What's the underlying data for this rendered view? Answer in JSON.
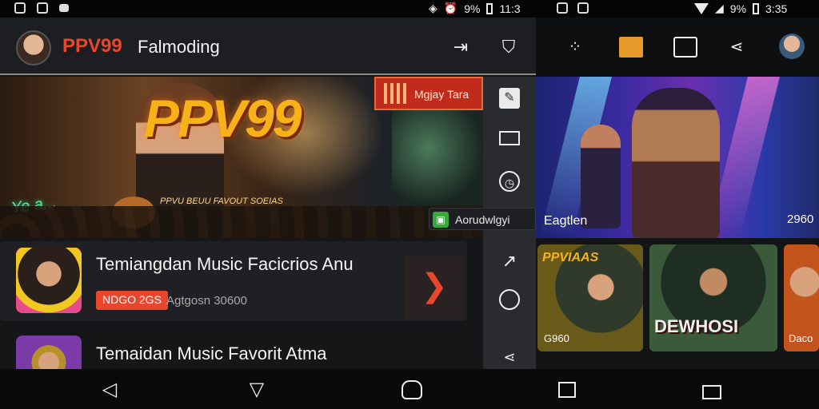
{
  "status_bar": {
    "left_percent": "9%",
    "left_time": "11:3",
    "right_percent": "9%",
    "right_time": "3:35"
  },
  "header": {
    "brand": "PPV99",
    "subtitle": "Falmoding",
    "icons": [
      "export-icon",
      "shield-icon"
    ]
  },
  "hero": {
    "logo": "PPV99",
    "tagline": "PPVU BEUU FAVOUT SOEIAS",
    "badge": "Mgjay Tara",
    "neon_sign": "Ye a..."
  },
  "toast": {
    "text": "Aorudwlgyi",
    "icon": "app-icon"
  },
  "rail": {
    "icons": [
      "edit-icon",
      "window-icon",
      "clock-icon",
      "arrow-icon",
      "circle-icon",
      "share-icon"
    ]
  },
  "list": {
    "items": [
      {
        "title": "Temiangdan Music Facicrios Anu",
        "tag": "NDGO 2GS",
        "meta": "Agtgosn 30600"
      },
      {
        "title": "Temaidan Music Favorit Atma"
      }
    ]
  },
  "right_top_bar": {
    "icons": [
      "dots-icon",
      "folder-icon",
      "box-icon",
      "share-icon",
      "avatar"
    ]
  },
  "right_hero": {
    "label_left": "Eagtlen",
    "label_right": "2960"
  },
  "right_cards": [
    {
      "title": "PPVIAAS",
      "subtitle": "G960"
    },
    {
      "title": "DEWHOSI",
      "subtitle": ""
    },
    {
      "title": "",
      "subtitle": "Daco"
    }
  ],
  "nav": {
    "buttons": [
      "back-icon",
      "home-icon",
      "recents-icon",
      "square-icon",
      "rotate-icon"
    ]
  },
  "colors": {
    "accent": "#e8472e",
    "logo_gold": "#f7b21a",
    "background": "#111214"
  }
}
